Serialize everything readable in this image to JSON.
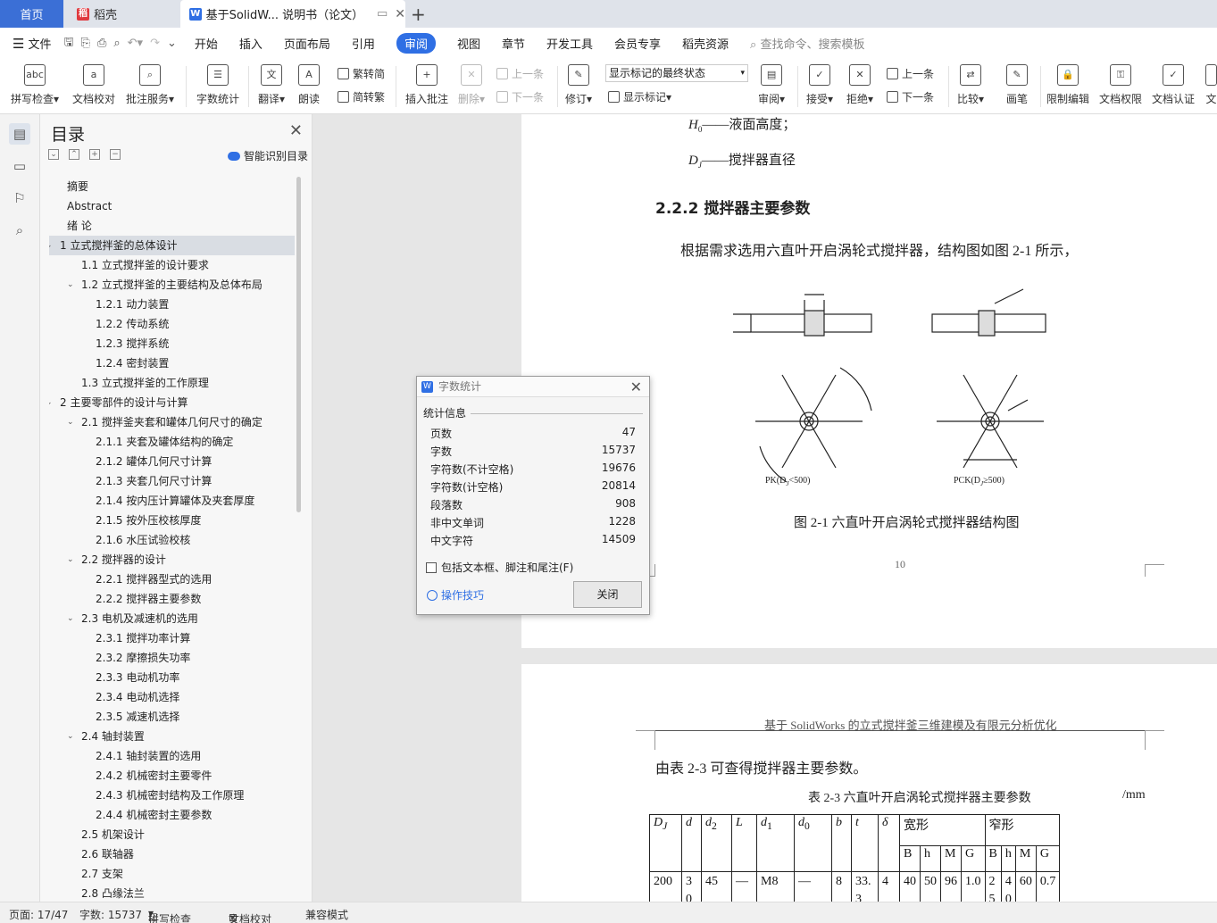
{
  "tabs": {
    "home": "首页",
    "daoke": "稻壳",
    "doc": "基于SolidW... 说明书（论文）"
  },
  "menu": {
    "file": "文件",
    "items": [
      "开始",
      "插入",
      "页面布局",
      "引用",
      "审阅",
      "视图",
      "章节",
      "开发工具",
      "会员专享",
      "稻壳资源"
    ],
    "search": "查找命令、搜索模板"
  },
  "ribbon": {
    "spell": "拼写检查",
    "proof": "文档校对",
    "annotate": "批注服务",
    "wordcount": "字数统计",
    "translate": "翻译",
    "read": "朗读",
    "t2s": "繁转简",
    "s2t": "简转繁",
    "insert_comment": "插入批注",
    "delete": "删除",
    "prev": "上一条",
    "next": "下一条",
    "revise": "修订",
    "mark_state": "显示标记的最终状态",
    "show_marks": "显示标记",
    "review": "审阅",
    "accept": "接受",
    "reject": "拒绝",
    "prev2": "上一条",
    "next2": "下一条",
    "compare": "比较",
    "pen": "画笔",
    "restrict": "限制编辑",
    "perm": "文档权限",
    "auth": "文档认证",
    "more": "文"
  },
  "toc": {
    "title": "目录",
    "smart": "智能识别目录",
    "items": [
      "摘要",
      "Abstract",
      "绪  论",
      "1  立式搅拌釜的总体设计",
      "1.1  立式搅拌釜的设计要求",
      "1.2  立式搅拌釜的主要结构及总体布局",
      "1.2.1  动力装置",
      "1.2.2  传动系统",
      "1.2.3  搅拌系统",
      "1.2.4  密封装置",
      "1.3  立式搅拌釜的工作原理",
      "2  主要零部件的设计与计算",
      "2.1  搅拌釜夹套和罐体几何尺寸的确定",
      "2.1.1  夹套及罐体结构的确定",
      "2.1.2  罐体几何尺寸计算",
      "2.1.3  夹套几何尺寸计算",
      "2.1.4  按内压计算罐体及夹套厚度",
      "2.1.5  按外压校核厚度",
      "2.1.6  水压试验校核",
      "2.2  搅拌器的设计",
      "2.2.1  搅拌器型式的选用",
      "2.2.2  搅拌器主要参数",
      "2.3  电机及减速机的选用",
      "2.3.1  搅拌功率计算",
      "2.3.2  摩擦损失功率",
      "2.3.3  电动机功率",
      "2.3.4  电动机选择",
      "2.3.5  减速机选择",
      "2.4  轴封装置",
      "2.4.1  轴封装置的选用",
      "2.4.2  机械密封主要零件",
      "2.4.3  机械密封结构及工作原理",
      "2.4.4  机械密封主要参数",
      "2.5  机架设计",
      "2.6  联轴器",
      "2.7  支架",
      "2.8  凸缘法兰"
    ]
  },
  "page1": {
    "h0_line": "——液面高度；",
    "dj_line": "——搅拌器直径",
    "heading": "2.2.2  搅拌器主要参数",
    "para": "根据需求选用六直叶开启涡轮式搅拌器，结构图如图 2-1 所示，",
    "fig_left": "PK(D",
    "fig_left2": "<500)",
    "fig_right": "PCK(D",
    "fig_right2": "≥500)",
    "caption": "图 2-1  六直叶开启涡轮式搅拌器结构图",
    "page_no": "10"
  },
  "page2": {
    "header": "基于 SolidWorks 的立式搅拌釜三维建模及有限元分析优化",
    "para": "由表 2-3 可查得搅拌器主要参数。",
    "table_title": "表 2-3    六直叶开启涡轮式搅拌器主要参数",
    "unit": "/mm",
    "wide": "宽形",
    "narrow": "窄形",
    "sub": [
      "B",
      "h",
      "M",
      "G",
      "B",
      "h",
      "M",
      "G"
    ],
    "row": [
      "200",
      "3\n0",
      "45",
      "—",
      "M8",
      "—",
      "8",
      "33.\n3",
      "4",
      "40",
      "50",
      "96",
      "1.0",
      "2\n5",
      "4\n0",
      "60",
      "0.7"
    ]
  },
  "dialog": {
    "title": "字数统计",
    "section": "统计信息",
    "rows": [
      {
        "label": "页数",
        "value": "47"
      },
      {
        "label": "字数",
        "value": "15737"
      },
      {
        "label": "字符数(不计空格)",
        "value": "19676"
      },
      {
        "label": "字符数(计空格)",
        "value": "20814"
      },
      {
        "label": "段落数",
        "value": "908"
      },
      {
        "label": "非中文单词",
        "value": "1228"
      },
      {
        "label": "中文字符",
        "value": "14509"
      }
    ],
    "checkbox": "包括文本框、脚注和尾注(F)",
    "tips": "操作技巧",
    "close": "关闭"
  },
  "status": {
    "page": "页面: 17/47",
    "words": "字数: 15737",
    "spell": "拼写检查",
    "proof": "文档校对",
    "compat": "兼容模式"
  }
}
